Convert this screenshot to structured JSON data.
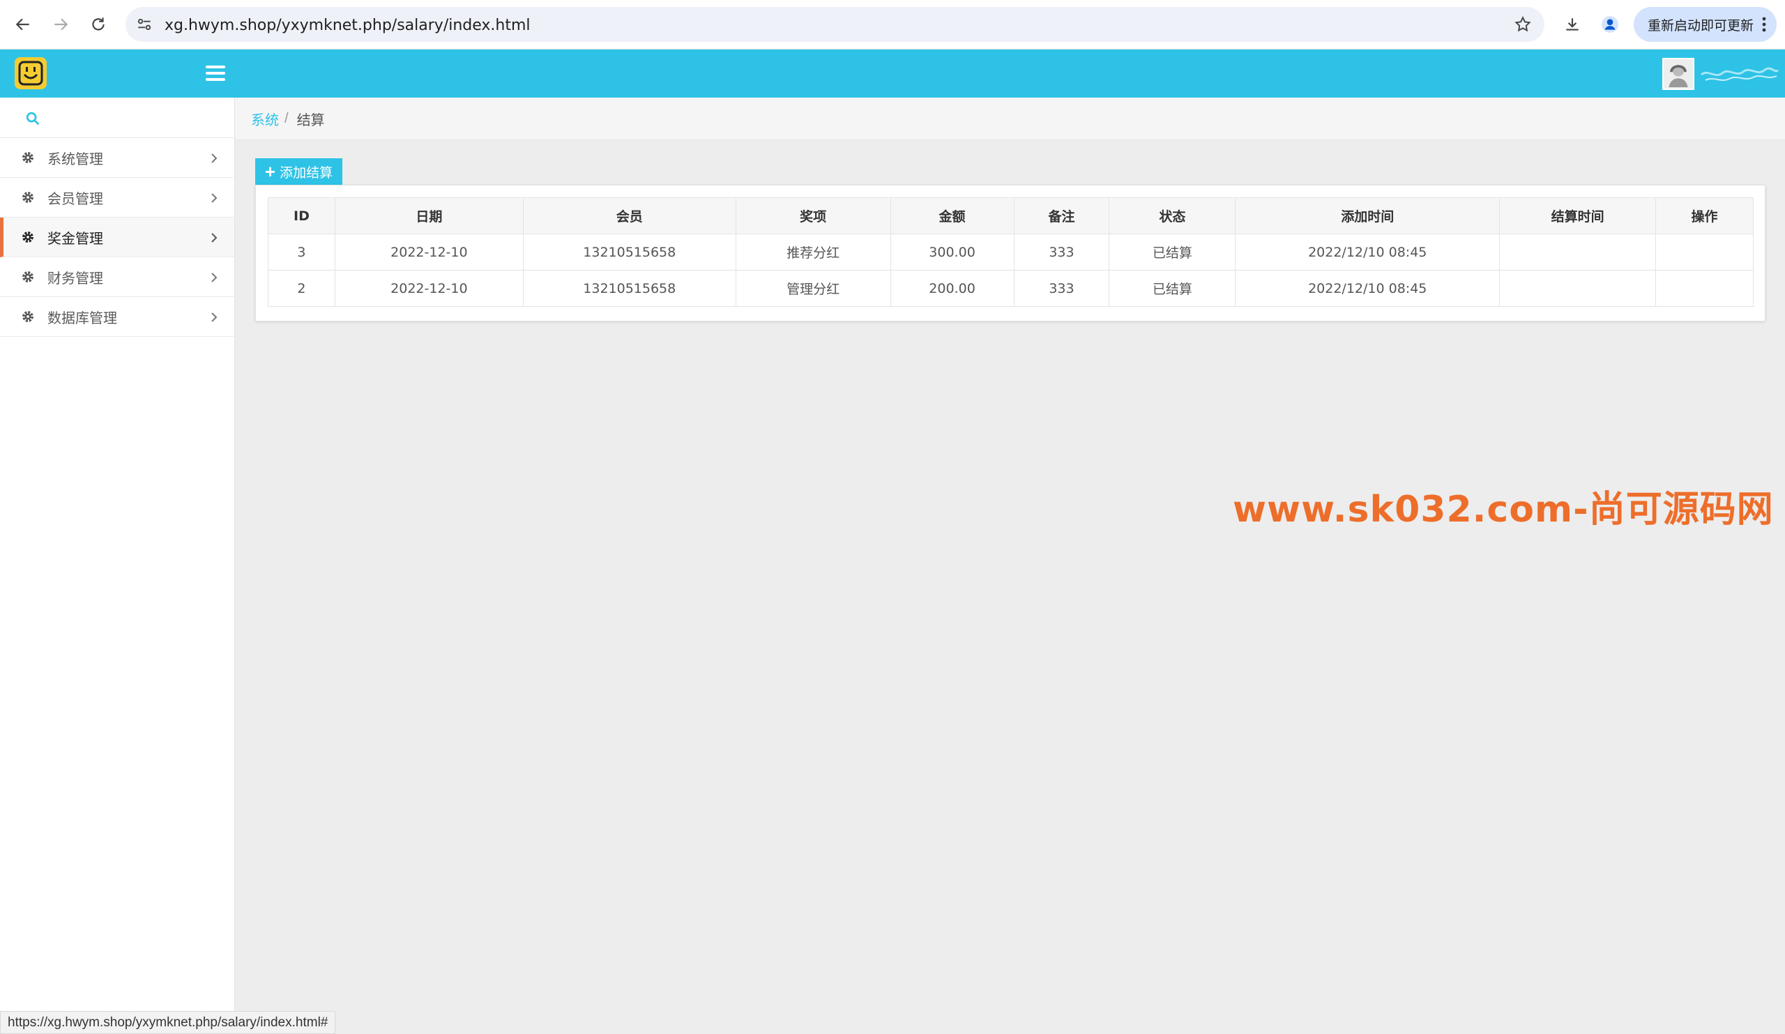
{
  "browser": {
    "url": "xg.hwym.shop/yxymknet.php/salary/index.html",
    "update_label": "重新启动即可更新"
  },
  "sidebar": {
    "items": [
      {
        "label": "系统管理"
      },
      {
        "label": "会员管理"
      },
      {
        "label": "奖金管理"
      },
      {
        "label": "财务管理"
      },
      {
        "label": "数据库管理"
      }
    ]
  },
  "breadcrumb": {
    "parent": "系统",
    "separator": "/",
    "current": "结算"
  },
  "toolbar": {
    "add_label": "添加结算"
  },
  "table": {
    "headers": [
      "ID",
      "日期",
      "会员",
      "奖项",
      "金额",
      "备注",
      "状态",
      "添加时间",
      "结算时间",
      "操作"
    ],
    "rows": [
      [
        "3",
        "2022-12-10",
        "13210515658",
        "推荐分红",
        "300.00",
        "333",
        "已结算",
        "2022/12/10 08:45",
        "",
        ""
      ],
      [
        "2",
        "2022-12-10",
        "13210515658",
        "管理分红",
        "200.00",
        "333",
        "已结算",
        "2022/12/10 08:45",
        "",
        ""
      ]
    ]
  },
  "watermark": "www.sk032.com-尚可源码网",
  "status_bar": "https://xg.hwym.shop/yxymknet.php/salary/index.html#",
  "colors": {
    "header": "#2ec3e6",
    "accent": "#e8733f",
    "watermark": "#ed6e2b"
  }
}
